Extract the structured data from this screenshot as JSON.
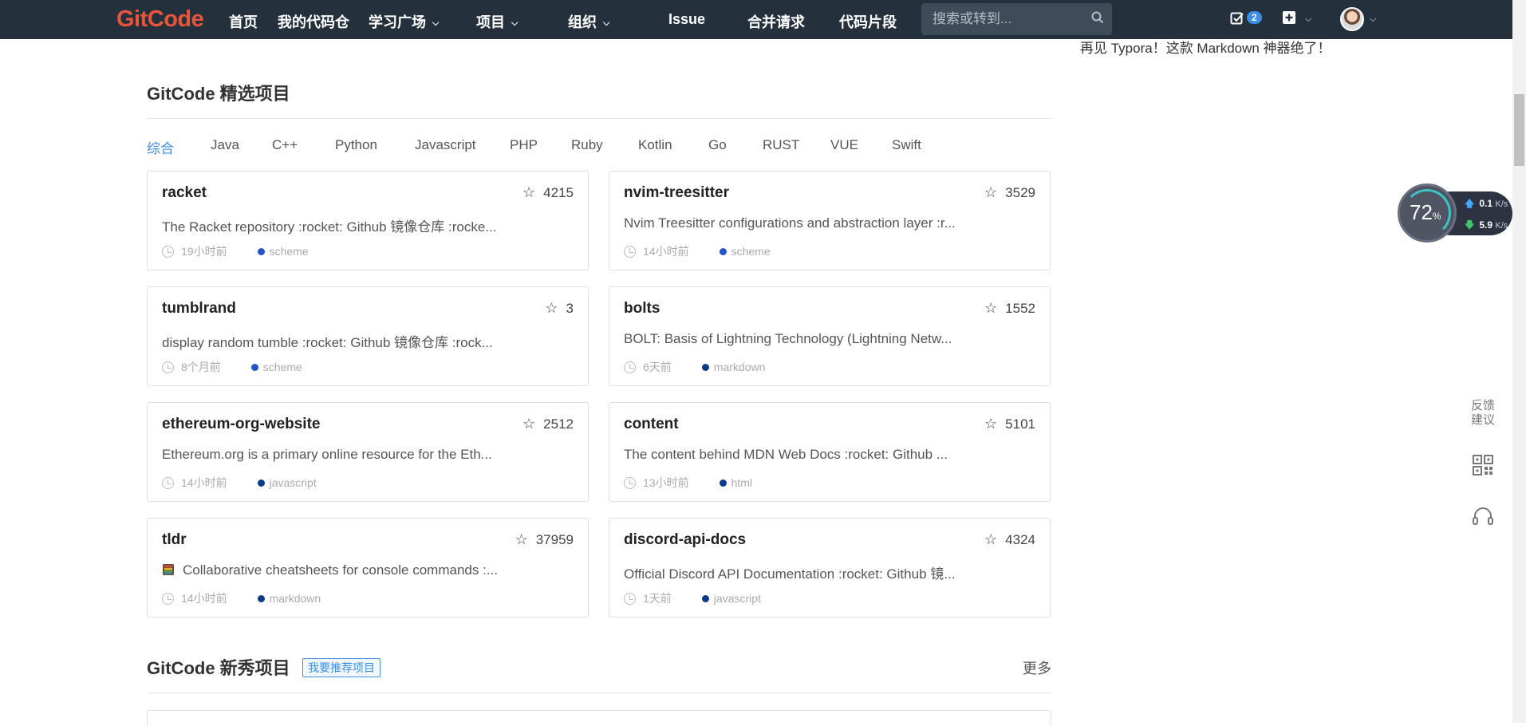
{
  "nav": {
    "logo": "GitCode",
    "items": [
      {
        "label": "首页",
        "chevron": false
      },
      {
        "label": "我的代码仓",
        "chevron": false
      },
      {
        "label": "学习广场",
        "chevron": true
      },
      {
        "label": "项目",
        "chevron": true
      },
      {
        "label": "组织",
        "chevron": true
      },
      {
        "label": "Issue",
        "chevron": false
      },
      {
        "label": "合并请求",
        "chevron": false
      },
      {
        "label": "代码片段",
        "chevron": false
      }
    ],
    "search_placeholder": "搜索或转到...",
    "todo_count": "2"
  },
  "side_article": "再见 Typora！这款 Markdown 神器绝了！",
  "featured": {
    "title": "GitCode 精选项目",
    "tabs": [
      "综合",
      "Java",
      "C++",
      "Python",
      "Javascript",
      "PHP",
      "Ruby",
      "Kotlin",
      "Go",
      "RUST",
      "VUE",
      "Swift"
    ],
    "active_tab": "综合",
    "projects": [
      {
        "name": "racket",
        "stars": "4215",
        "desc": "The Racket repository :rocket: Github 镜像仓库 :rocke...",
        "time": "19小时前",
        "lang": "scheme",
        "lang_color": "#2255cc",
        "icon": ""
      },
      {
        "name": "nvim-treesitter",
        "stars": "3529",
        "desc": "Nvim Treesitter configurations and abstraction layer :r...",
        "time": "14小时前",
        "lang": "scheme",
        "lang_color": "#2255cc",
        "icon": ""
      },
      {
        "name": "tumblrand",
        "stars": "3",
        "desc": "display random tumble :rocket: Github 镜像仓库 :rock...",
        "time": "8个月前",
        "lang": "scheme",
        "lang_color": "#2255cc",
        "icon": ""
      },
      {
        "name": "bolts",
        "stars": "1552",
        "desc": "BOLT: Basis of Lightning Technology (Lightning Netw...",
        "time": "6天前",
        "lang": "markdown",
        "lang_color": "#0b3a8c",
        "icon": ""
      },
      {
        "name": "ethereum-org-website",
        "stars": "2512",
        "desc": "Ethereum.org is a primary online resource for the Eth...",
        "time": "14小时前",
        "lang": "javascript",
        "lang_color": "#0b3a8c",
        "icon": ""
      },
      {
        "name": "content",
        "stars": "5101",
        "desc": "The content behind MDN Web Docs :rocket: Github ...",
        "time": "13小时前",
        "lang": "html",
        "lang_color": "#0b3a8c",
        "icon": ""
      },
      {
        "name": "tldr",
        "stars": "37959",
        "desc": "Collaborative cheatsheets for console commands :...",
        "time": "14小时前",
        "lang": "markdown",
        "lang_color": "#0b3a8c",
        "icon": "notebook-icon"
      },
      {
        "name": "discord-api-docs",
        "stars": "4324",
        "desc": "Official Discord API Documentation :rocket: Github 镜...",
        "time": "1天前",
        "lang": "javascript",
        "lang_color": "#0b3a8c",
        "icon": ""
      }
    ]
  },
  "newbie": {
    "title": "GitCode 新秀项目",
    "recommend_label": "我要推荐项目",
    "more_label": "更多"
  },
  "speed": {
    "percent": "72",
    "percent_unit": "%",
    "up": "0.1",
    "down": "5.9",
    "unit": "K/s"
  },
  "floating": {
    "feedback": "反馈建议"
  }
}
